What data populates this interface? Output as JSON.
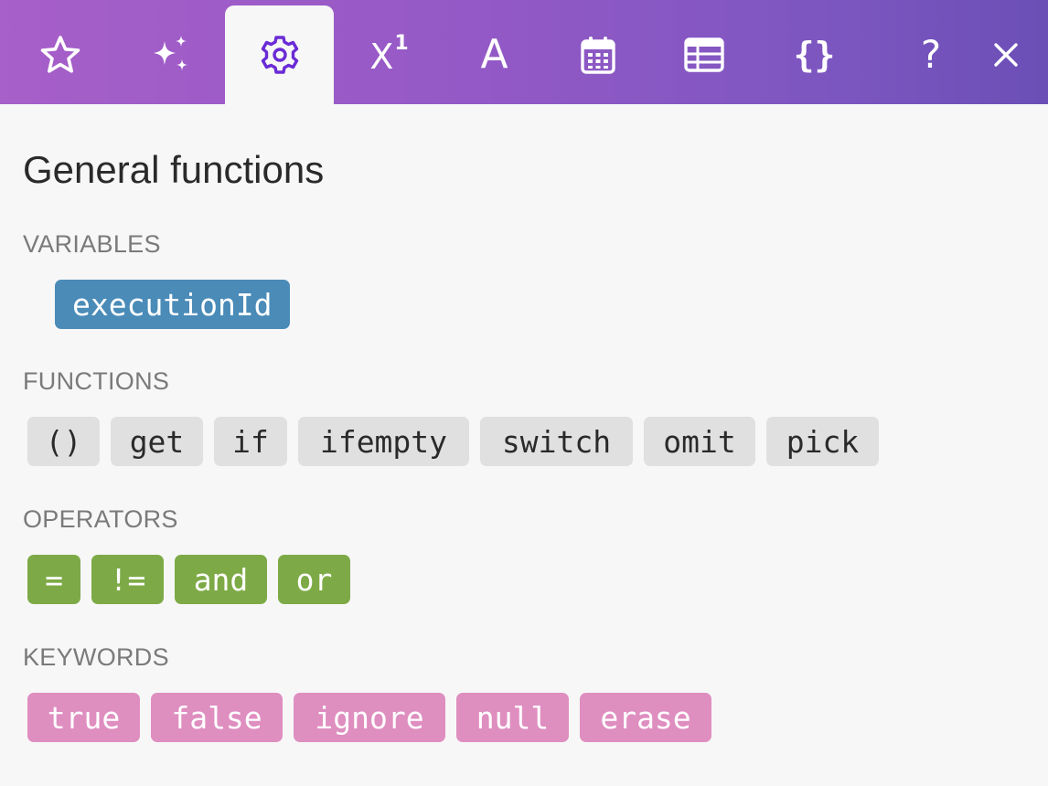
{
  "tabs": [
    {
      "id": "favorites",
      "icon": "star-icon",
      "active": false
    },
    {
      "id": "ai",
      "icon": "sparkles-icon",
      "active": false
    },
    {
      "id": "general",
      "icon": "gear-icon",
      "active": true
    },
    {
      "id": "math",
      "icon": "superscript-x-icon",
      "label": "X",
      "sup": "1",
      "active": false
    },
    {
      "id": "text",
      "icon": "letter-a-icon",
      "label": "A",
      "active": false
    },
    {
      "id": "date",
      "icon": "calendar-icon",
      "active": false
    },
    {
      "id": "array",
      "icon": "table-icon",
      "active": false
    },
    {
      "id": "json",
      "icon": "braces-icon",
      "label": "{}",
      "active": false
    }
  ],
  "toolbar": {
    "help_label": "?",
    "close_icon": "close-icon"
  },
  "colors": {
    "header_gradient_start": "#a75fc9",
    "header_gradient_end": "#6b4fb6",
    "active_icon": "#6a2bd6",
    "variable_pill": "#4a8bb8",
    "function_pill": "#e0e0e0",
    "operator_pill": "#7daa46",
    "keyword_pill": "#df8ec0"
  },
  "panel": {
    "title": "General functions",
    "variables_label": "VARIABLES",
    "variables": [
      "executionId"
    ],
    "functions_label": "FUNCTIONS",
    "functions": [
      "()",
      "get",
      "if",
      "ifempty",
      "switch",
      "omit",
      "pick"
    ],
    "operators_label": "OPERATORS",
    "operators": [
      "=",
      "!=",
      "and",
      "or"
    ],
    "keywords_label": "KEYWORDS",
    "keywords": [
      "true",
      "false",
      "ignore",
      "null",
      "erase"
    ]
  }
}
